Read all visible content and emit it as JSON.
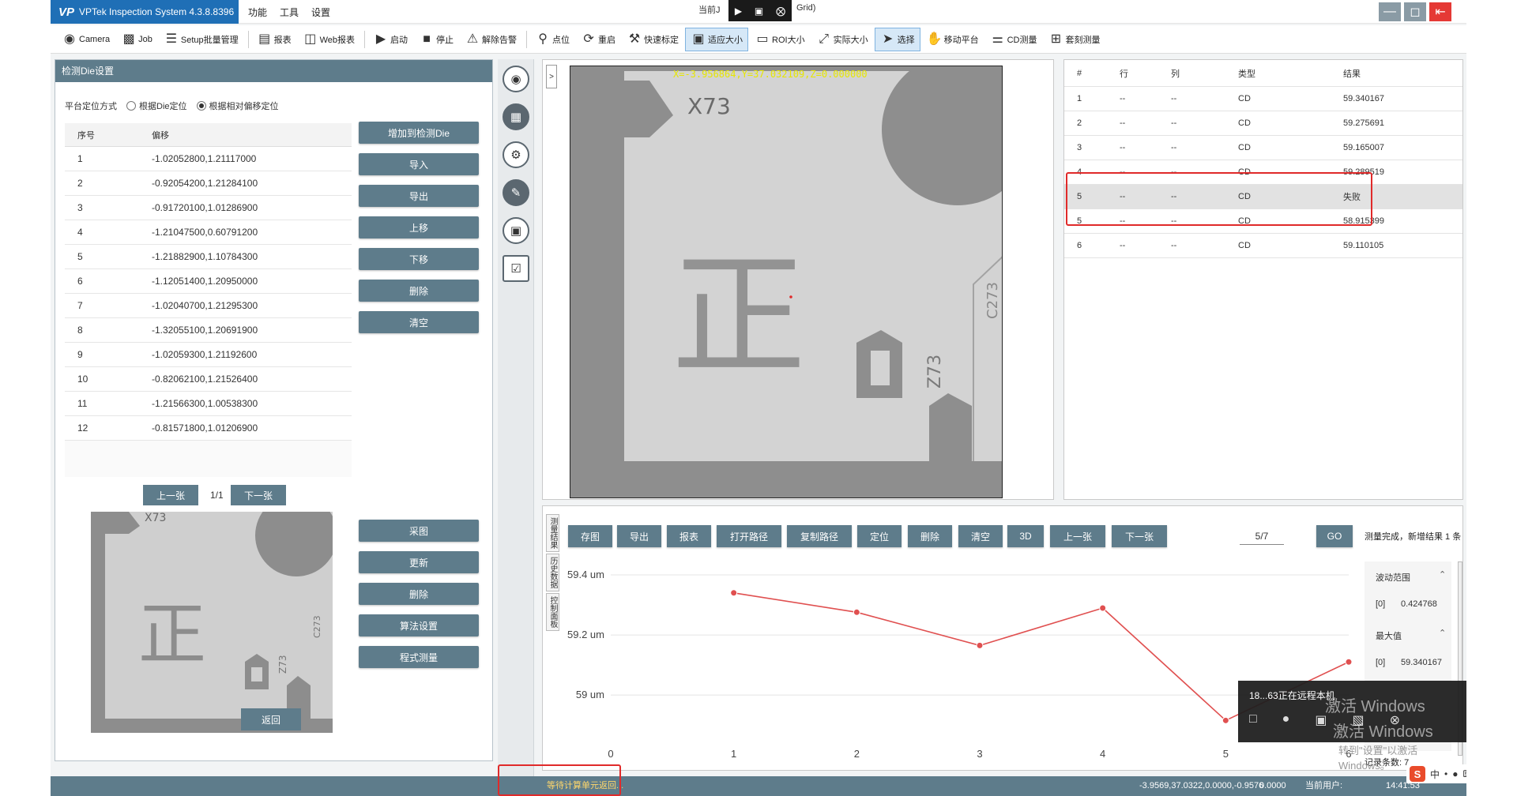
{
  "app": {
    "brand_logo": "VP",
    "title": "VPTek Inspection System 4.3.8.8396",
    "menus": [
      "功能",
      "工具",
      "设置"
    ],
    "title_center": "当前J",
    "title_tail": "Grid)"
  },
  "toolbar": {
    "items": [
      {
        "label": "Camera",
        "icon": "camera-icon"
      },
      {
        "label": "Job",
        "icon": "briefcase-icon"
      },
      {
        "label": "Setup批量管理",
        "icon": "list-check-icon"
      },
      {
        "label": "报表",
        "icon": "report-icon"
      },
      {
        "label": "Web报表",
        "icon": "web-report-icon"
      },
      {
        "label": "启动",
        "icon": "play-icon"
      },
      {
        "label": "停止",
        "icon": "stop-icon"
      },
      {
        "label": "解除告警",
        "icon": "alarm-off-icon"
      },
      {
        "label": "点位",
        "icon": "pin-icon"
      },
      {
        "label": "重启",
        "icon": "restart-icon"
      },
      {
        "label": "快速标定",
        "icon": "wrench-icon"
      },
      {
        "label": "适应大小",
        "icon": "fit-icon"
      },
      {
        "label": "ROI大小",
        "icon": "roi-icon"
      },
      {
        "label": "实际大小",
        "icon": "actual-size-icon"
      },
      {
        "label": "选择",
        "icon": "pointer-icon"
      },
      {
        "label": "移动平台",
        "icon": "hand-icon"
      },
      {
        "label": "CD测量",
        "icon": "ruler-icon"
      },
      {
        "label": "套刻测量",
        "icon": "plus-square-icon"
      }
    ]
  },
  "left_panel": {
    "title": "检测Die设置",
    "mode_label": "平台定位方式",
    "mode_options": [
      "根据Die定位",
      "根据相对偏移定位"
    ],
    "mode_selected": "根据相对偏移定位",
    "table_headers": [
      "序号",
      "偏移"
    ],
    "offsets": [
      {
        "idx": "1",
        "offset": "-1.02052800,1.21117000"
      },
      {
        "idx": "2",
        "offset": "-0.92054200,1.21284100"
      },
      {
        "idx": "3",
        "offset": "-0.91720100,1.01286900"
      },
      {
        "idx": "4",
        "offset": "-1.21047500,0.60791200"
      },
      {
        "idx": "5",
        "offset": "-1.21882900,1.10784300"
      },
      {
        "idx": "6",
        "offset": "-1.12051400,1.20950000"
      },
      {
        "idx": "7",
        "offset": "-1.02040700,1.21295300"
      },
      {
        "idx": "8",
        "offset": "-1.32055100,1.20691900"
      },
      {
        "idx": "9",
        "offset": "-1.02059300,1.21192600"
      },
      {
        "idx": "10",
        "offset": "-0.82062100,1.21526400"
      },
      {
        "idx": "11",
        "offset": "-1.21566300,1.00538300"
      },
      {
        "idx": "12",
        "offset": "-0.81571800,1.01206900"
      }
    ],
    "buttons_top": [
      "增加到检测Die",
      "导入",
      "导出",
      "上移",
      "下移",
      "删除",
      "清空"
    ],
    "prev_label": "上一张",
    "page": "1/1",
    "next_label": "下一张",
    "buttons_bottom": [
      "采图",
      "更新",
      "删除",
      "算法设置",
      "程式测量"
    ],
    "back_label": "返回",
    "thumb_labels": {
      "x73": "X73",
      "z73": "Z73",
      "c273": "C273",
      "zheng": "正"
    }
  },
  "image_view": {
    "toggle": ">",
    "coord": "X=-3.956864,Y=37.032109,Z=0.000000",
    "labels": {
      "x73": "X73",
      "z73": "Z73",
      "c273": "C273",
      "zheng": "正"
    }
  },
  "results": {
    "headers": [
      "#",
      "行",
      "列",
      "类型",
      "结果"
    ],
    "rows": [
      {
        "n": "1",
        "row": "--",
        "col": "--",
        "type": "CD",
        "result": "59.340167"
      },
      {
        "n": "2",
        "row": "--",
        "col": "--",
        "type": "CD",
        "result": "59.275691"
      },
      {
        "n": "3",
        "row": "--",
        "col": "--",
        "type": "CD",
        "result": "59.165007"
      },
      {
        "n": "4",
        "row": "--",
        "col": "--",
        "type": "CD",
        "result": "59.289519"
      },
      {
        "n": "5",
        "row": "--",
        "col": "--",
        "type": "CD",
        "result": "失败"
      },
      {
        "n": "5",
        "row": "--",
        "col": "--",
        "type": "CD",
        "result": "58.915399"
      },
      {
        "n": "6",
        "row": "--",
        "col": "--",
        "type": "CD",
        "result": "59.110105"
      }
    ],
    "selected_row": 4,
    "highlight_color": "#e02a2a"
  },
  "bottom": {
    "vtabs": [
      "测量结果",
      "历史数据",
      "控制面板"
    ],
    "buttons": [
      "存图",
      "导出",
      "报表",
      "打开路径",
      "复制路径",
      "定位",
      "删除",
      "清空",
      "3D",
      "上一张",
      "下一张"
    ],
    "page_value": "5/7",
    "go_label": "GO",
    "status_msg": "测量完成，新增结果 1 条",
    "stats": {
      "range_label": "波动范围",
      "range_index": "[0]",
      "range_value": "0.424768",
      "max_label": "最大值",
      "max_index": "[0]",
      "max_value": "59.340167"
    },
    "record_count": "记录条数: 7"
  },
  "chart_data": {
    "type": "line",
    "x": [
      1,
      2,
      3,
      4,
      5,
      6
    ],
    "series": [
      {
        "values": [
          59.340167,
          59.275691,
          59.165007,
          59.289519,
          58.915399,
          59.110105
        ],
        "color": "#e05050"
      }
    ],
    "xticks": [
      "0",
      "1",
      "2",
      "3",
      "4",
      "5",
      "6"
    ],
    "yticks": [
      "59 um",
      "59.2 um",
      "59.4 um"
    ],
    "ytick_values": [
      59.0,
      59.2,
      59.4
    ],
    "xlim": [
      0,
      6
    ],
    "ylim": [
      58.84,
      59.45
    ],
    "grid": "horizontal"
  },
  "statusbar": {
    "left": "等待计算单元返回...",
    "coord": "-3.9569,37.0322,0.0000,-0.9576",
    "zero": "0.0000",
    "user": "当前用户:",
    "time": "14:41:53"
  },
  "overlay": {
    "remote_text": "18...63正在远程本机",
    "watermark1": "激活 Windows",
    "watermark2": "激活 Windows",
    "watermark3": "转到\"设置\"以激活 Windows。",
    "ime_text": "中"
  },
  "colors": {
    "accent": "#5e7c8b",
    "brand": "#1f6fb6",
    "close_button": "#e53935"
  }
}
